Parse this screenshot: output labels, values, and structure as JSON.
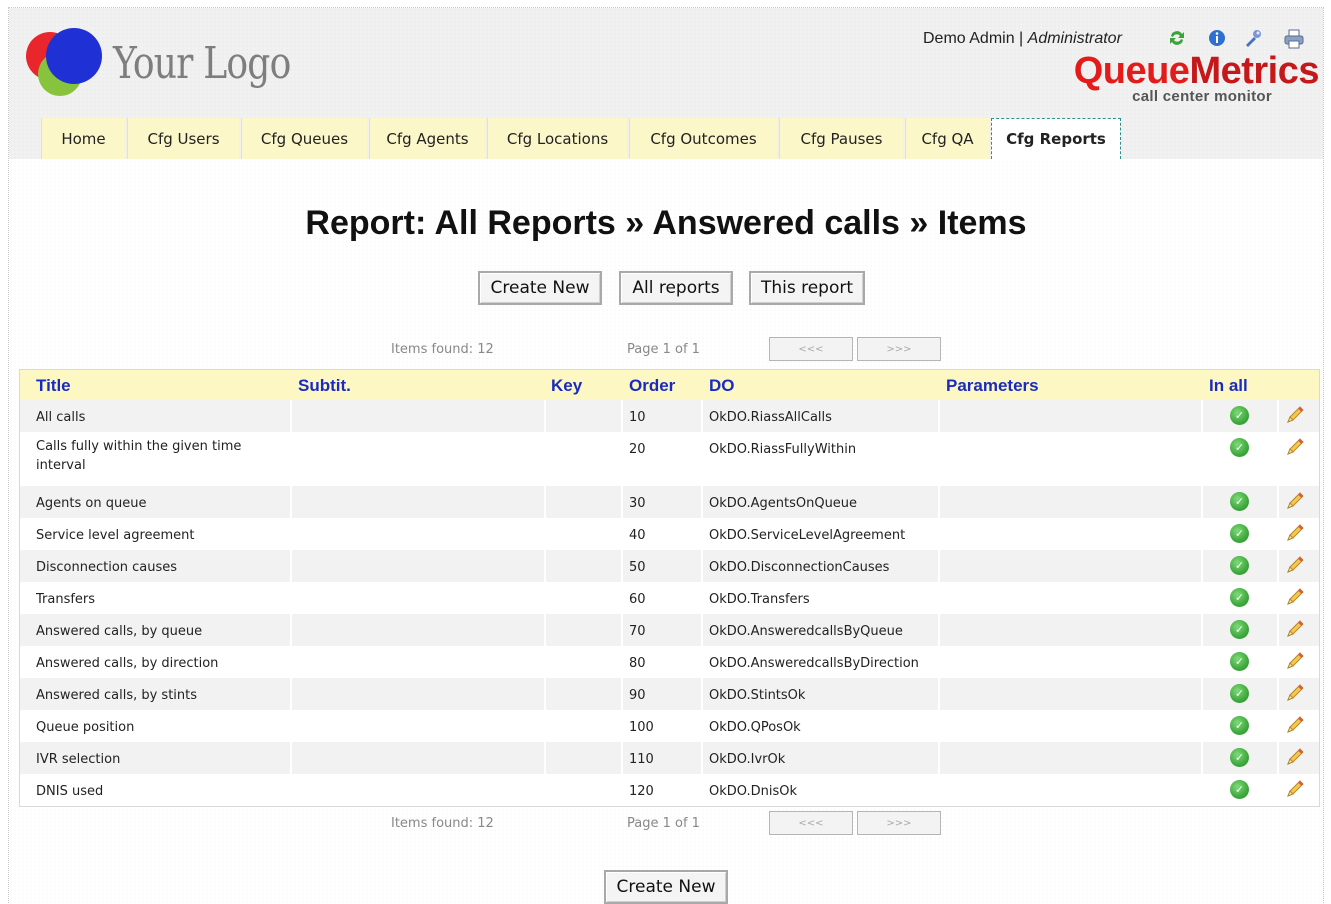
{
  "header": {
    "logo_text": "Your Logo",
    "user_name": "Demo Admin",
    "separator": "|",
    "user_role": "Administrator",
    "brand_name_1": "Queue",
    "brand_name_2": "Metrics",
    "brand_tagline": "call center monitor",
    "icons": [
      "refresh-icon",
      "info-icon",
      "tools-icon",
      "print-icon"
    ]
  },
  "tabs": [
    {
      "label": "Home"
    },
    {
      "label": "Cfg Users"
    },
    {
      "label": "Cfg Queues"
    },
    {
      "label": "Cfg Agents"
    },
    {
      "label": "Cfg Locations"
    },
    {
      "label": "Cfg Outcomes"
    },
    {
      "label": "Cfg Pauses"
    },
    {
      "label": "Cfg QA"
    },
    {
      "label": "Cfg Reports",
      "active": true
    }
  ],
  "title": "Report: All Reports » Answered calls » Items",
  "buttons": {
    "create_new": "Create New",
    "all_reports": "All reports",
    "this_report": "This report"
  },
  "pager": {
    "items_found": "Items found: 12",
    "page": "Page 1 of 1",
    "prev": "<<<",
    "next": ">>>"
  },
  "table": {
    "headers": {
      "title": "Title",
      "subtitle": "Subtit.",
      "key": "Key",
      "order": "Order",
      "do": "DO",
      "parameters": "Parameters",
      "in_all": "In all"
    },
    "rows": [
      {
        "title": "All calls",
        "subtitle": "",
        "key": "",
        "order": "10",
        "do": "OkDO.RiassAllCalls",
        "parameters": "",
        "in_all": true
      },
      {
        "title": "Calls fully within the given time interval",
        "subtitle": "",
        "key": "",
        "order": "20",
        "do": "OkDO.RiassFullyWithin",
        "parameters": "",
        "in_all": true
      },
      {
        "title": "Agents on queue",
        "subtitle": "",
        "key": "",
        "order": "30",
        "do": "OkDO.AgentsOnQueue",
        "parameters": "",
        "in_all": true
      },
      {
        "title": "Service level agreement",
        "subtitle": "",
        "key": "",
        "order": "40",
        "do": "OkDO.ServiceLevelAgreement",
        "parameters": "",
        "in_all": true
      },
      {
        "title": "Disconnection causes",
        "subtitle": "",
        "key": "",
        "order": "50",
        "do": "OkDO.DisconnectionCauses",
        "parameters": "",
        "in_all": true
      },
      {
        "title": "Transfers",
        "subtitle": "",
        "key": "",
        "order": "60",
        "do": "OkDO.Transfers",
        "parameters": "",
        "in_all": true
      },
      {
        "title": "Answered calls, by queue",
        "subtitle": "",
        "key": "",
        "order": "70",
        "do": "OkDO.AnsweredcallsByQueue",
        "parameters": "",
        "in_all": true
      },
      {
        "title": "Answered calls, by direction",
        "subtitle": "",
        "key": "",
        "order": "80",
        "do": "OkDO.AnsweredcallsByDirection",
        "parameters": "",
        "in_all": true
      },
      {
        "title": "Answered calls, by stints",
        "subtitle": "",
        "key": "",
        "order": "90",
        "do": "OkDO.StintsOk",
        "parameters": "",
        "in_all": true
      },
      {
        "title": "Queue position",
        "subtitle": "",
        "key": "",
        "order": "100",
        "do": "OkDO.QPosOk",
        "parameters": "",
        "in_all": true
      },
      {
        "title": "IVR selection",
        "subtitle": "",
        "key": "",
        "order": "110",
        "do": "OkDO.IvrOk",
        "parameters": "",
        "in_all": true
      },
      {
        "title": "DNIS used",
        "subtitle": "",
        "key": "",
        "order": "120",
        "do": "OkDO.DnisOk",
        "parameters": "",
        "in_all": true
      }
    ]
  }
}
